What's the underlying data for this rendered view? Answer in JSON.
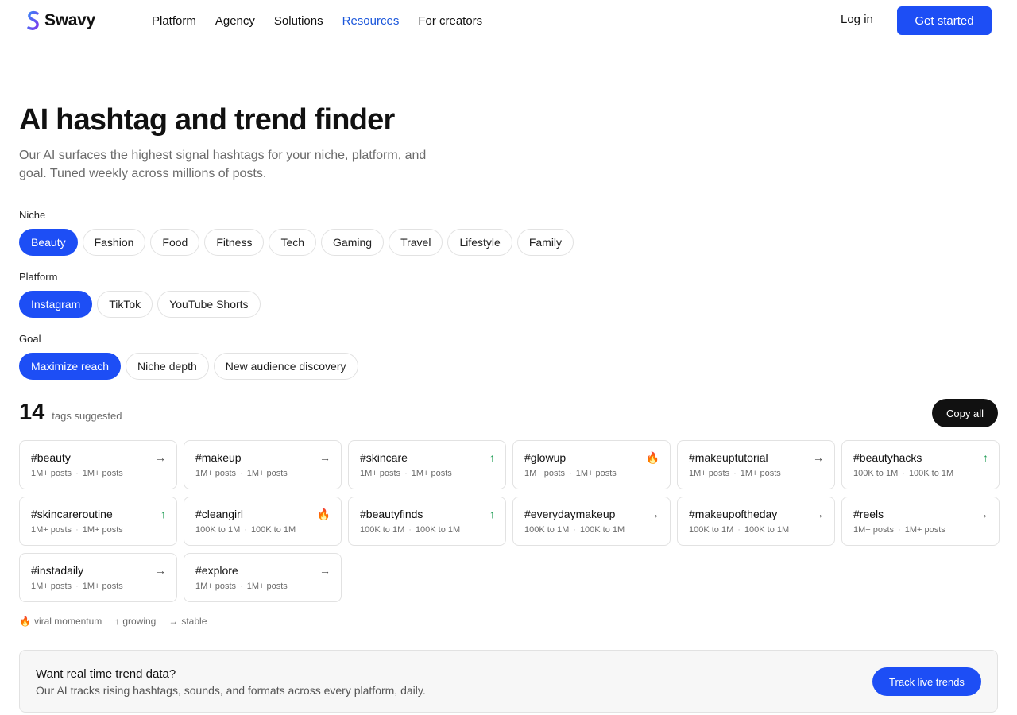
{
  "header": {
    "logo_text": "Swavy",
    "nav": [
      "Platform",
      "Agency",
      "Solutions",
      "Resources",
      "For creators"
    ],
    "active_nav": "Resources",
    "login": "Log in",
    "cta": "Get started",
    "accent_color": "#1d4ef5"
  },
  "hero": {
    "title": "AI hashtag and trend finder",
    "subtitle": "Our AI surfaces the highest signal hashtags for your niche, platform, and goal. Tuned weekly across millions of posts."
  },
  "filters": {
    "niche": {
      "label": "Niche",
      "options": [
        "Beauty",
        "Fashion",
        "Food",
        "Fitness",
        "Tech",
        "Gaming",
        "Travel",
        "Lifestyle",
        "Family"
      ],
      "selected": "Beauty"
    },
    "platform": {
      "label": "Platform",
      "options": [
        "Instagram",
        "TikTok",
        "YouTube Shorts"
      ],
      "selected": "Instagram"
    },
    "goal": {
      "label": "Goal",
      "options": [
        "Maximize reach",
        "Niche depth",
        "New audience discovery"
      ],
      "selected": "Maximize reach"
    }
  },
  "results": {
    "count": "14",
    "count_label": "tags suggested",
    "copy_all": "Copy all"
  },
  "tags": [
    {
      "tag": "#beauty",
      "volume": "1M+ posts",
      "trend": "stable"
    },
    {
      "tag": "#makeup",
      "volume": "1M+ posts",
      "trend": "stable"
    },
    {
      "tag": "#skincare",
      "volume": "1M+ posts",
      "trend": "growing"
    },
    {
      "tag": "#glowup",
      "volume": "1M+ posts",
      "trend": "viral"
    },
    {
      "tag": "#makeuptutorial",
      "volume": "1M+ posts",
      "trend": "stable"
    },
    {
      "tag": "#beautyhacks",
      "volume": "100K to 1M",
      "trend": "growing"
    },
    {
      "tag": "#skincareroutine",
      "volume": "1M+ posts",
      "trend": "growing"
    },
    {
      "tag": "#cleangirl",
      "volume": "100K to 1M",
      "trend": "viral"
    },
    {
      "tag": "#beautyfinds",
      "volume": "100K to 1M",
      "trend": "growing"
    },
    {
      "tag": "#everydaymakeup",
      "volume": "100K to 1M",
      "trend": "stable"
    },
    {
      "tag": "#makeupoftheday",
      "volume": "100K to 1M",
      "trend": "stable"
    },
    {
      "tag": "#reels",
      "volume": "1M+ posts",
      "trend": "stable"
    },
    {
      "tag": "#instadaily",
      "volume": "1M+ posts",
      "trend": "stable"
    },
    {
      "tag": "#explore",
      "volume": "1M+ posts",
      "trend": "stable"
    }
  ],
  "trend_icons": {
    "viral": "🔥",
    "growing": "↑",
    "stable": "→"
  },
  "legend": {
    "viral": "viral momentum",
    "growing": "growing",
    "stable": "stable"
  },
  "banner": {
    "title": "Want real time trend data?",
    "text": "Our AI tracks rising hashtags, sounds, and formats across every platform, daily.",
    "button": "Track live trends"
  }
}
